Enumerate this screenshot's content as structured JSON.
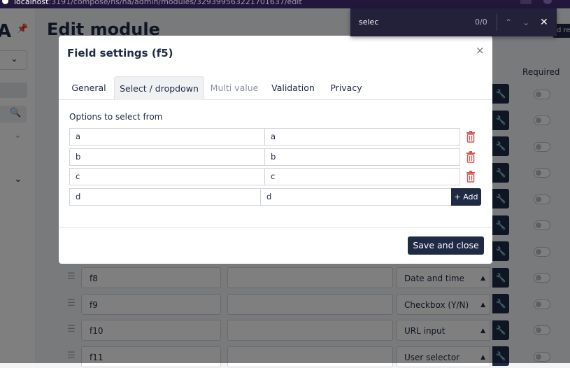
{
  "browser": {
    "url_host": "localhost",
    "url_path": ":3191/compose/ns/na/admin/modules/329399563221701637/edit"
  },
  "page": {
    "title": "Edit module",
    "required_column": "Required",
    "right_badge": "d rec"
  },
  "background_fields": [
    {
      "name": "f8",
      "kind": "Date and time"
    },
    {
      "name": "f9",
      "kind": "Checkbox (Y/N)"
    },
    {
      "name": "f10",
      "kind": "URL input"
    },
    {
      "name": "f11",
      "kind": "User selector"
    }
  ],
  "modal": {
    "title": "Field settings (f5)",
    "close_glyph": "×",
    "tabs": [
      {
        "label": "General",
        "active": false,
        "muted": false
      },
      {
        "label": "Select / dropdown",
        "active": true,
        "muted": false
      },
      {
        "label": "Multi value",
        "active": false,
        "muted": true
      },
      {
        "label": "Validation",
        "active": false,
        "muted": false
      },
      {
        "label": "Privacy",
        "active": false,
        "muted": false
      }
    ],
    "options_label": "Options to select from",
    "options": [
      {
        "value": "a",
        "text": "a"
      },
      {
        "value": "b",
        "text": "b"
      },
      {
        "value": "c",
        "text": "c"
      }
    ],
    "new_option": {
      "value": "d",
      "text": "d"
    },
    "add_label": "+ Add",
    "save_label": "Save and close"
  },
  "findbar": {
    "query": "selec",
    "count": "0/0"
  },
  "colors": {
    "primary": "#1f2a44",
    "danger": "#d9534f",
    "findbar_bg": "#23213a"
  }
}
